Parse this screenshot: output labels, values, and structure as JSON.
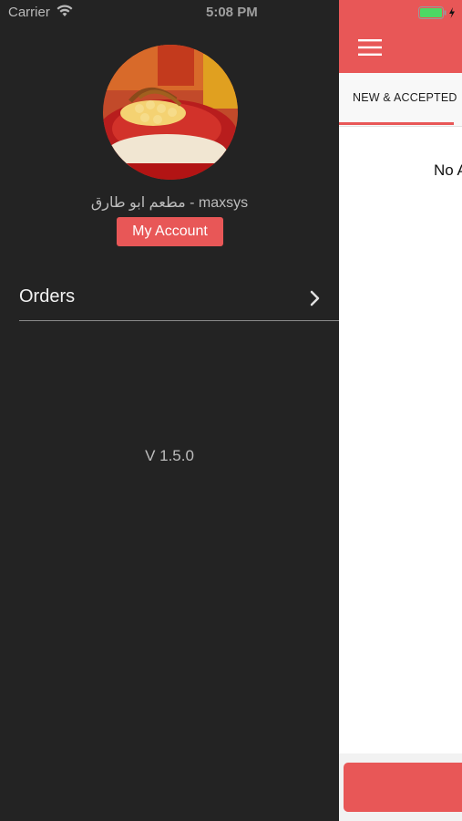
{
  "status_bar": {
    "carrier": "Carrier",
    "time": "5:08 PM"
  },
  "drawer": {
    "restaurant_name": "مطعم ابو طارق - maxsys",
    "account_button": "My Account",
    "menu": [
      {
        "label": "Orders",
        "icon": "chevron-right-icon"
      }
    ],
    "version": "V 1.5.0"
  },
  "main": {
    "tab_label": "NEW & ACCEPTED",
    "empty_message": "No A"
  },
  "colors": {
    "accent": "#e85757",
    "drawer_bg": "#232323",
    "battery": "#4cd964"
  }
}
